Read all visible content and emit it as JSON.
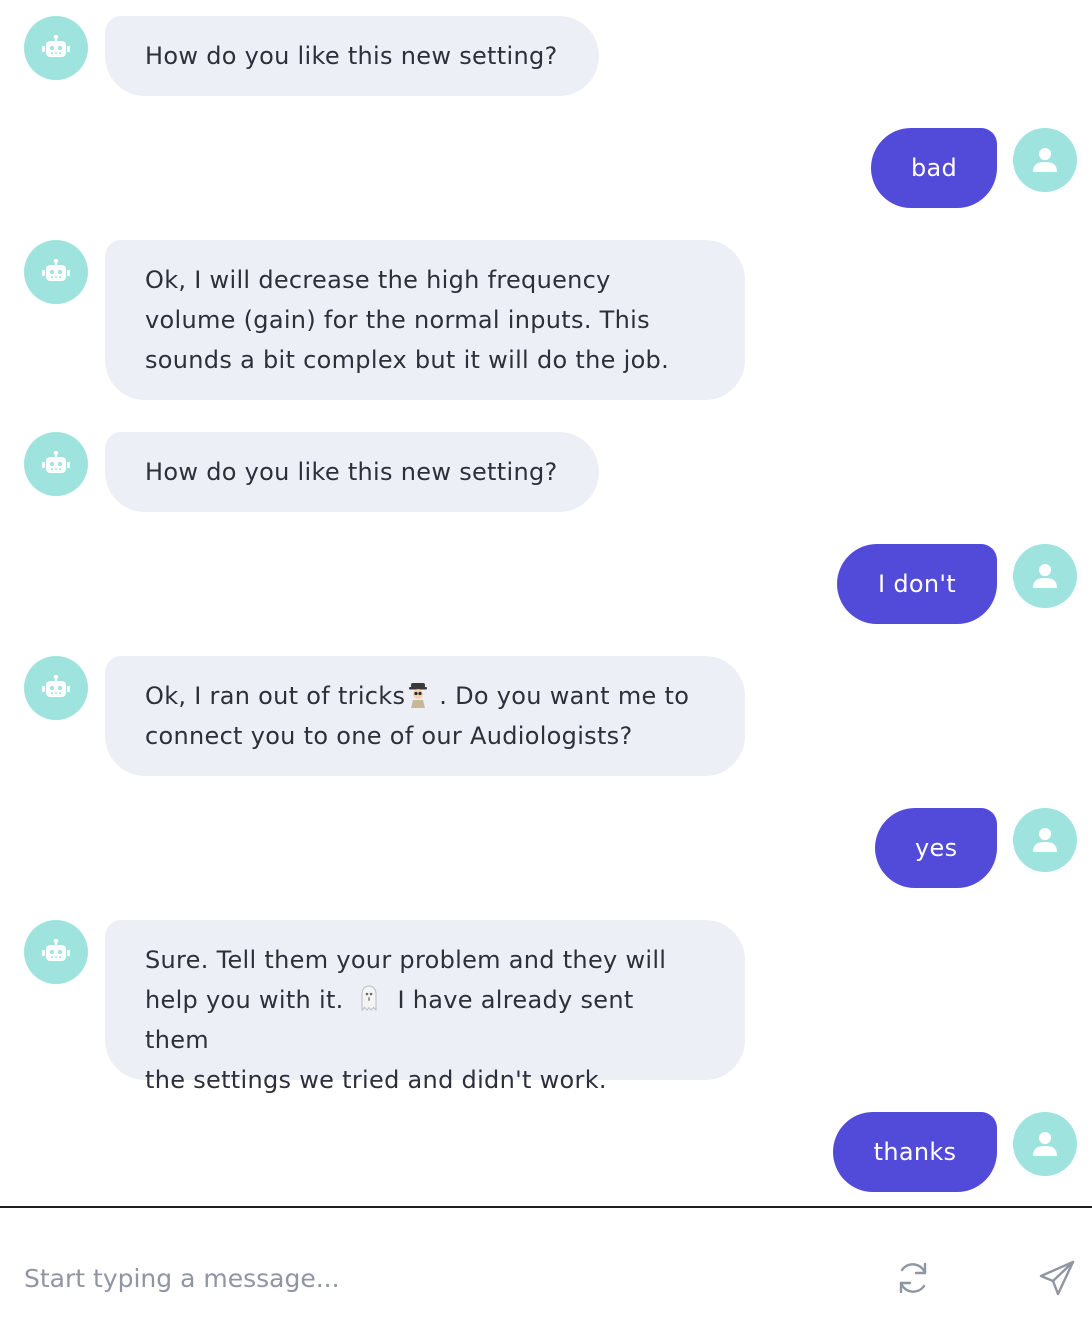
{
  "messages": [
    {
      "sender": "bot",
      "text": "How do you like this new setting?"
    },
    {
      "sender": "user",
      "text": "bad"
    },
    {
      "sender": "bot",
      "lines": [
        "Ok, I will decrease the high frequency",
        "volume (gain) for the normal inputs. This",
        "sounds a bit complex but it will do the job."
      ]
    },
    {
      "sender": "bot",
      "text": "How do you like this new setting?"
    },
    {
      "sender": "user",
      "text": "I don't"
    },
    {
      "sender": "bot",
      "line1_before_emoji": "Ok, I ran out of tricks",
      "line1_after_emoji": ". Do you want me to",
      "line2": "connect you to one of our Audiologists?",
      "emoji": "detective-emoji"
    },
    {
      "sender": "user",
      "text": "yes"
    },
    {
      "sender": "bot",
      "line1": "Sure. Tell them your problem and they will",
      "line2_before_emoji": "help you with it.",
      "line2_after_emoji": "I have already sent them",
      "line3": "the settings we tried and didn't work.",
      "emoji": "ghost-emoji"
    },
    {
      "sender": "user",
      "text": "thanks"
    }
  ],
  "composer": {
    "placeholder": "Start typing a message...",
    "refresh_icon": "refresh-icon",
    "send_icon": "send-icon"
  },
  "colors": {
    "bot_bubble": "#eceff5",
    "user_bubble": "#524ad9",
    "avatar": "#9fe3df",
    "text": "#2d2f3a"
  }
}
